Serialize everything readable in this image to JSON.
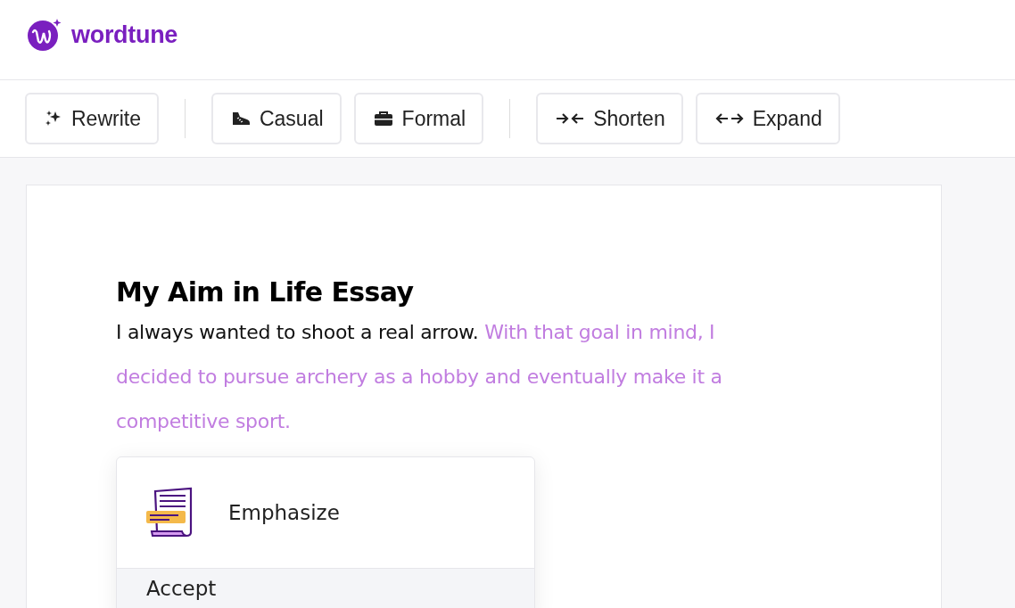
{
  "brand": {
    "name": "wordtune"
  },
  "toolbar": {
    "groups": [
      [
        {
          "label": "Rewrite",
          "kind": "rewrite"
        }
      ],
      [
        {
          "label": "Casual",
          "kind": "casual"
        },
        {
          "label": "Formal",
          "kind": "formal"
        }
      ],
      [
        {
          "label": "Shorten",
          "kind": "shorten"
        },
        {
          "label": "Expand",
          "kind": "expand"
        }
      ]
    ]
  },
  "document": {
    "title": "My Aim in Life Essay",
    "segments": [
      {
        "text": "I always wanted to shoot a real arrow. ",
        "highlighted": false
      },
      {
        "text": "With that goal in mind, I decided to pursue archery as a hobby and eventually make it a competitive sport.",
        "highlighted": true
      }
    ]
  },
  "popup": {
    "suggestion": "Emphasize",
    "action": "Accept"
  }
}
